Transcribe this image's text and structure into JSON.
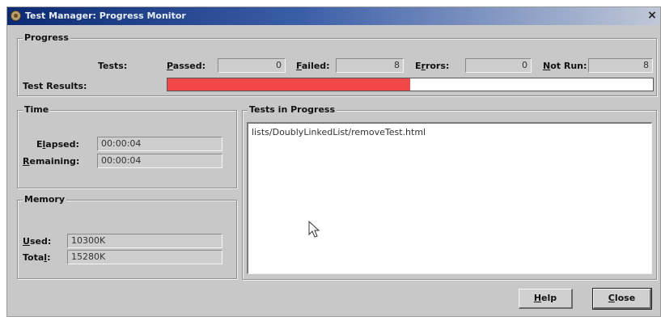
{
  "window": {
    "title": "Test Manager: Progress Monitor",
    "close_glyph": "×"
  },
  "progress": {
    "legend": "Progress",
    "tests_label": "Tests:",
    "passed": {
      "mnemonic": "P",
      "rest": "assed:",
      "value": "0"
    },
    "failed": {
      "mnemonic": "F",
      "rest": "ailed:",
      "value": "8"
    },
    "errors": {
      "lead": "E",
      "mnemonic": "r",
      "rest": "rors:",
      "value": "0"
    },
    "notrun": {
      "mnemonic": "N",
      "rest": "ot Run:",
      "value": "8"
    },
    "results_label": "Test Results:",
    "results_fraction": 0.5,
    "fill_color": "#f04848"
  },
  "time": {
    "legend": "Time",
    "elapsed": {
      "lead": "E",
      "mnemonic": "l",
      "rest": "apsed:",
      "value": "00:00:04"
    },
    "remaining": {
      "mnemonic": "R",
      "rest": "emaining:",
      "value": "00:00:04"
    }
  },
  "memory": {
    "legend": "Memory",
    "used": {
      "mnemonic": "U",
      "rest": "sed:",
      "value": "10300K"
    },
    "total": {
      "lead": "Tota",
      "mnemonic": "l",
      "rest": ":",
      "value": "15280K"
    }
  },
  "in_progress": {
    "legend": "Tests in Progress",
    "items": [
      "lists/DoublyLinkedList/removeTest.html"
    ]
  },
  "buttons": {
    "help": {
      "mnemonic": "H",
      "rest": "elp"
    },
    "close": {
      "mnemonic": "C",
      "rest": "lose"
    }
  }
}
